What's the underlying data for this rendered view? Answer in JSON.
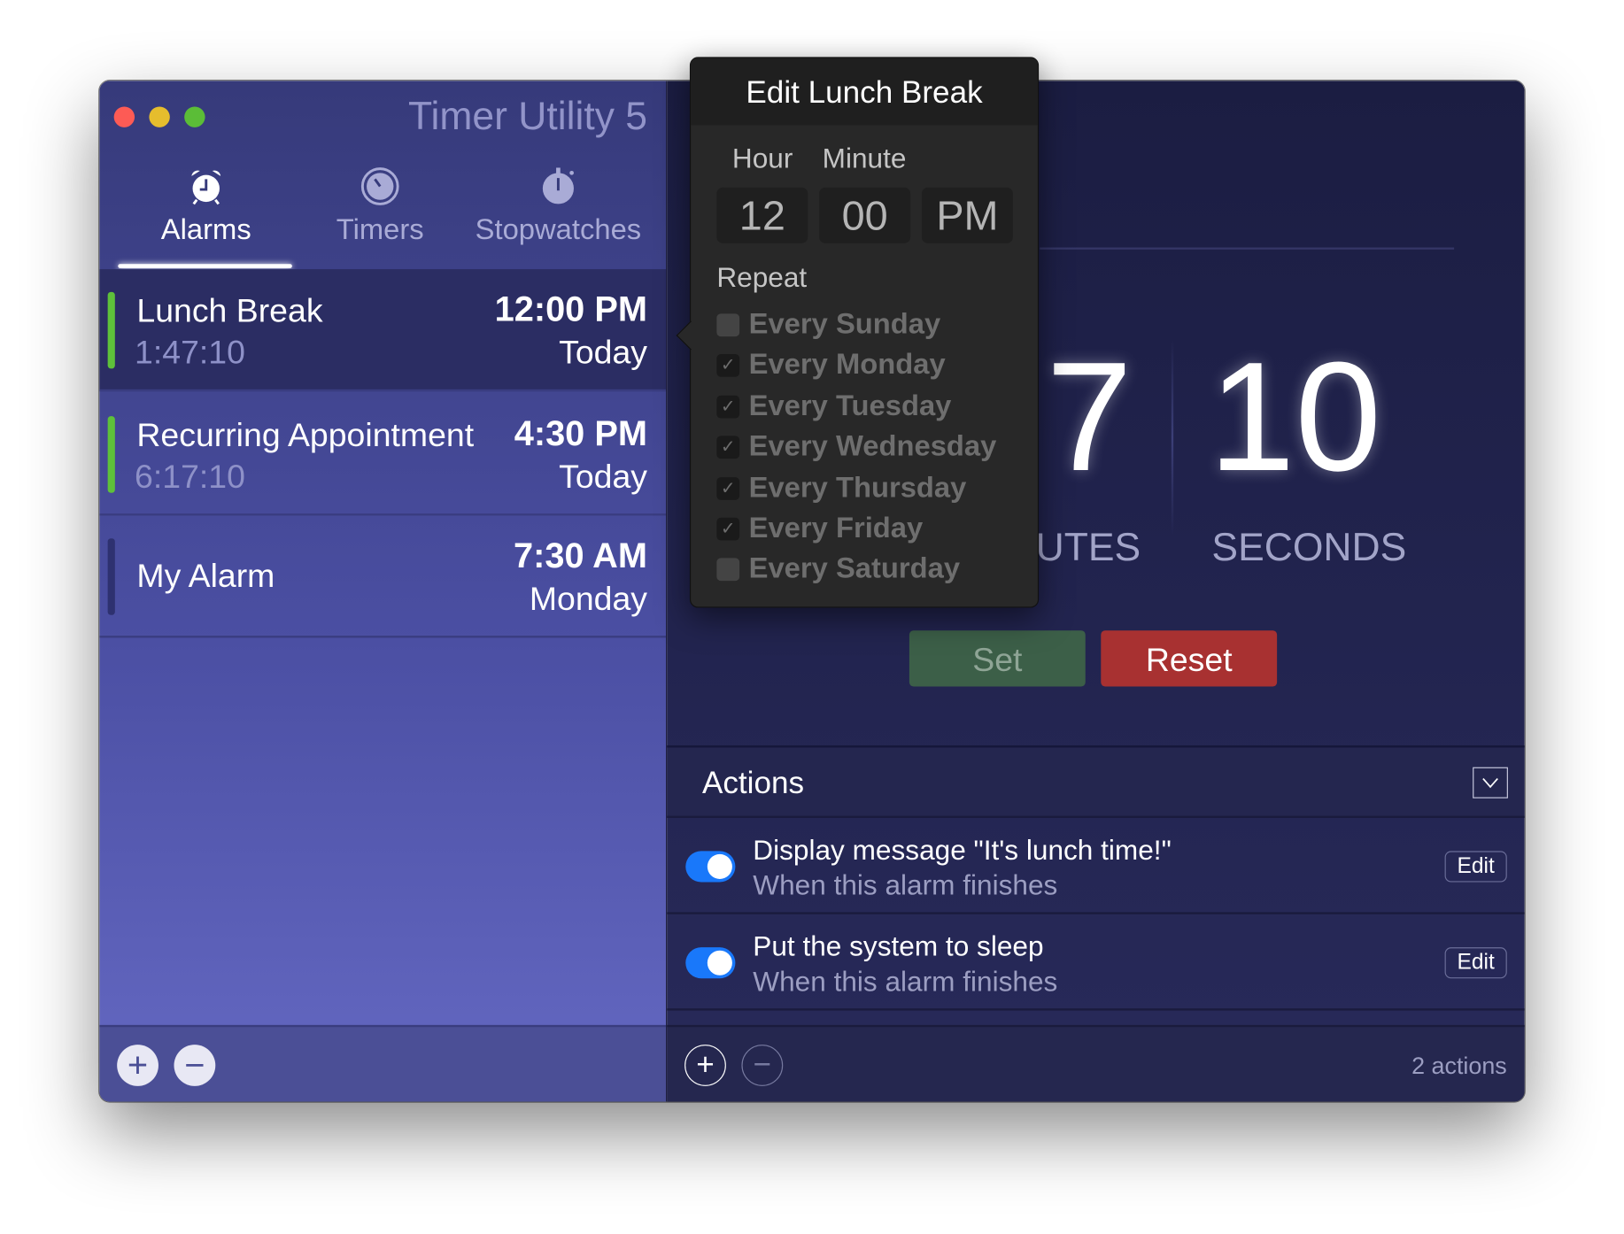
{
  "window": {
    "title": "Timer Utility 5"
  },
  "tabs": [
    {
      "label": "Alarms",
      "icon": "alarm-clock-icon",
      "active": true
    },
    {
      "label": "Timers",
      "icon": "timer-icon"
    },
    {
      "label": "Stopwatches",
      "icon": "stopwatch-icon"
    }
  ],
  "alarms": [
    {
      "name": "Lunch Break",
      "remaining": "1:47:10",
      "time": "12:00 PM",
      "day": "Today",
      "enabled": true,
      "selected": true
    },
    {
      "name": "Recurring Appointment",
      "remaining": "6:17:10",
      "time": "4:30 PM",
      "day": "Today",
      "enabled": true
    },
    {
      "name": "My Alarm",
      "remaining": "",
      "time": "7:30 AM",
      "day": "Monday",
      "enabled": false
    }
  ],
  "sidebar_footer": {
    "add": "+",
    "remove": "−"
  },
  "popup": {
    "title": "Edit Lunch Break",
    "hour_label": "Hour",
    "minute_label": "Minute",
    "hour": "12",
    "minute": "00",
    "ampm": "PM",
    "repeat_label": "Repeat",
    "days": [
      {
        "label": "Every Sunday",
        "checked": false
      },
      {
        "label": "Every Monday",
        "checked": true
      },
      {
        "label": "Every Tuesday",
        "checked": true
      },
      {
        "label": "Every Wednesday",
        "checked": true
      },
      {
        "label": "Every Thursday",
        "checked": true
      },
      {
        "label": "Every Friday",
        "checked": true
      },
      {
        "label": "Every Saturday",
        "checked": false
      }
    ]
  },
  "countdown": {
    "minutes_digit": "7",
    "minutes_label": "UTES",
    "seconds": "10",
    "seconds_label": "SECONDS"
  },
  "buttons": {
    "set": "Set",
    "reset": "Reset"
  },
  "actions": {
    "title": "Actions",
    "items": [
      {
        "title": "Display message \"It's lunch time!\"",
        "subtitle": "When this alarm finishes",
        "enabled": true,
        "edit": "Edit"
      },
      {
        "title": "Put the system to sleep",
        "subtitle": "When this alarm finishes",
        "enabled": true,
        "edit": "Edit"
      }
    ],
    "count": "2 actions"
  },
  "colors": {
    "accent_green": "#5ec13a",
    "toggle_blue": "#1978fa",
    "set": "#3c5f48",
    "reset": "#a83131"
  }
}
